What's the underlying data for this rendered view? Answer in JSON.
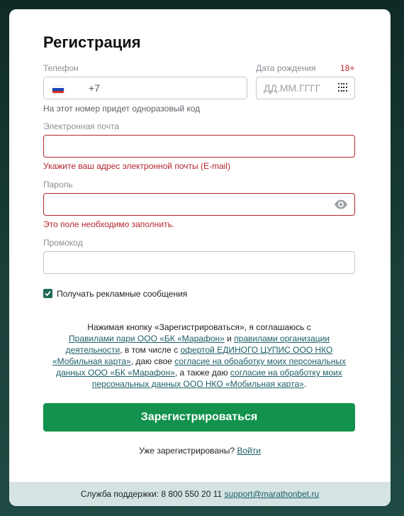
{
  "title": "Регистрация",
  "phone": {
    "label": "Телефон",
    "prefix": "+7",
    "value": "",
    "hint": "На этот номер придет одноразовый код"
  },
  "birth": {
    "label": "Дата рождения",
    "age_badge": "18+",
    "placeholder": "ДД.ММ.ГГГГ",
    "value": ""
  },
  "email": {
    "label": "Электронная почта",
    "value": "",
    "error": "Укажите ваш адрес электронной почты (E-mail)"
  },
  "password": {
    "label": "Пароль",
    "value": "",
    "error": "Это поле необходимо заполнить."
  },
  "promo": {
    "label": "Промокод",
    "value": ""
  },
  "ads_checkbox": {
    "label": "Получать рекламные сообщения",
    "checked": true
  },
  "agreement": {
    "t1": "Нажимая кнопку «Зарегистрироваться», я соглашаюсь с",
    "l1": "Правилами пари ООО «БК «Марафон»",
    "t2": " и ",
    "l2": "правилами организации деятельности",
    "t3": ", в том числе с ",
    "l3": "офертой ЕДИНОГО ЦУПИС ООО НКО «Мобильная карта»",
    "t4": ", даю свое ",
    "l4": "согласие на обработку моих персональных данных ООО «БК «Марафон»",
    "t5": ", а также даю ",
    "l5": "согласие на обработку моих персональных данных ООО НКО «Мобильная карта»",
    "t6": "."
  },
  "submit_label": "Зарегистрироваться",
  "login": {
    "question": "Уже зарегистрированы?",
    "link": "Войти"
  },
  "footer": {
    "text": "Служба поддержки: 8 800 550 20 11",
    "email": "support@marathonbet.ru"
  },
  "colors": {
    "accent": "#12924c",
    "error": "#b3262d",
    "link": "#1d5f66"
  }
}
